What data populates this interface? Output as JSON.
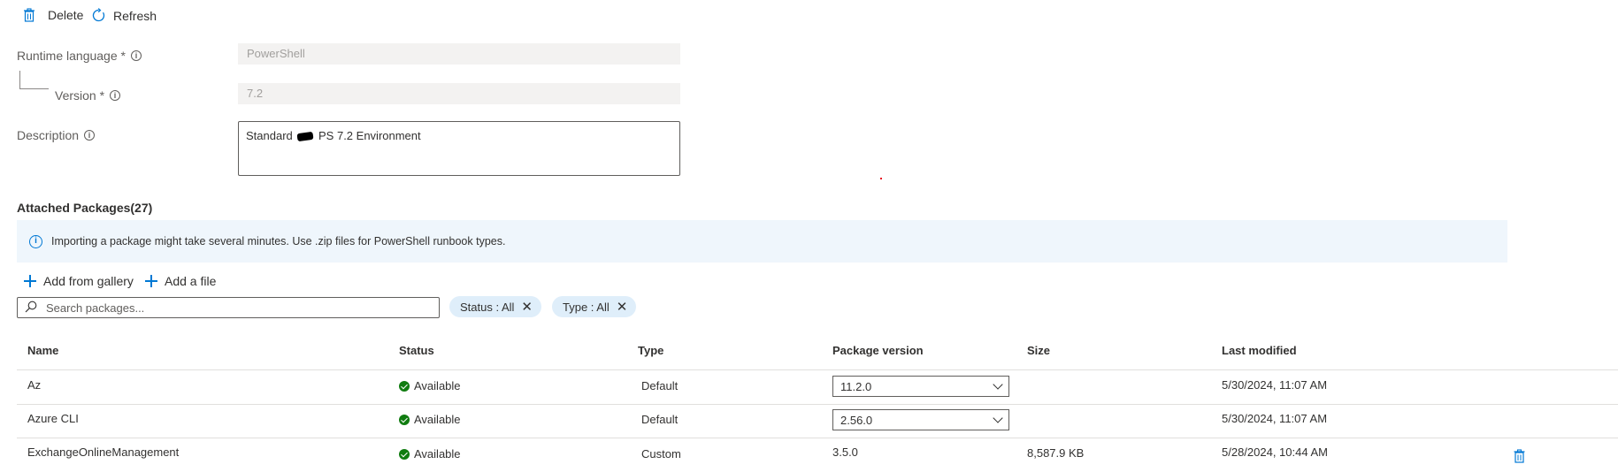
{
  "toolbar": {
    "delete_label": "Delete",
    "refresh_label": "Refresh"
  },
  "form": {
    "runtime_label": "Runtime language *",
    "runtime_value": "PowerShell",
    "version_label": "Version *",
    "version_value": "7.2",
    "description_label": "Description",
    "description_before": "Standard",
    "description_after": "PS 7.2 Environment"
  },
  "packages": {
    "title": "Attached Packages(27)",
    "banner_text": "Importing a package might take several minutes. Use .zip files for PowerShell runbook types.",
    "add_gallery_label": "Add from gallery",
    "add_file_label": "Add a file",
    "search_placeholder": "Search packages...",
    "filters": [
      {
        "label": "Status : All"
      },
      {
        "label": "Type : All"
      }
    ],
    "columns": [
      "Name",
      "Status",
      "Type",
      "Package version",
      "Size",
      "Last modified"
    ],
    "rows": [
      {
        "name": "Az",
        "status": "Available",
        "type": "Default",
        "version": "11.2.0",
        "size": "",
        "modified": "5/30/2024, 11:07 AM"
      },
      {
        "name": "Azure CLI",
        "status": "Available",
        "type": "Default",
        "version": "2.56.0",
        "size": "",
        "modified": "5/30/2024, 11:07 AM"
      },
      {
        "name": "ExchangeOnlineManagement",
        "status": "Available",
        "type": "Custom",
        "version": "3.5.0",
        "size": "8,587.9 KB",
        "modified": "5/28/2024, 10:44 AM"
      }
    ]
  },
  "icons": {
    "delete": "trash-icon",
    "refresh": "refresh-icon",
    "info": "info-icon",
    "search": "search-icon",
    "add": "plus-icon",
    "dismiss": "close-icon",
    "status": "check-circle-icon",
    "dropdown": "chevron-down-icon"
  },
  "colors": {
    "accent": "#0078d4",
    "available": "#107c10",
    "banner_bg": "#eff6fc",
    "pill_bg": "#dfeefa"
  }
}
